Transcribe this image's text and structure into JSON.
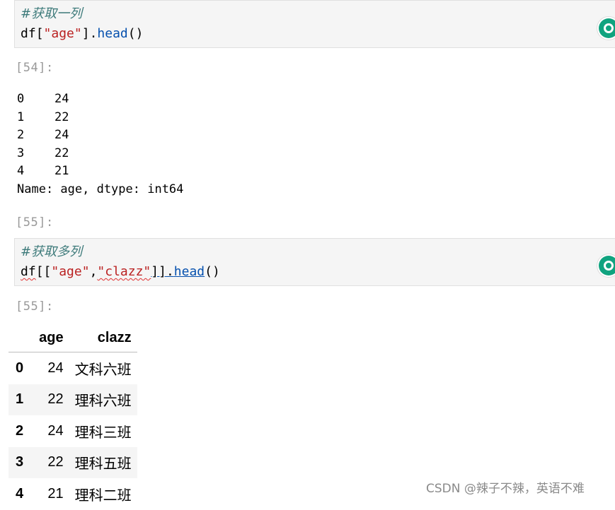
{
  "cells": [
    {
      "comment": "#获取一列",
      "code": {
        "var": "df",
        "open": "[",
        "str": "\"age\"",
        "close": "]",
        "dot": ".",
        "method": "head",
        "paren": "()"
      }
    },
    {
      "comment": "#获取多列",
      "code": {
        "var": "df",
        "open": "[[",
        "str1": "\"age\"",
        "comma": ",",
        "str2": "\"clazz\"",
        "close": "]]",
        "dot": ".",
        "method": "head",
        "paren": "()"
      }
    }
  ],
  "prompts": {
    "out1": "[54]:",
    "in2": "[55]:",
    "out2": "[55]:"
  },
  "series_output": {
    "rows": [
      {
        "index": "0",
        "value": "24"
      },
      {
        "index": "1",
        "value": "22"
      },
      {
        "index": "2",
        "value": "24"
      },
      {
        "index": "3",
        "value": "22"
      },
      {
        "index": "4",
        "value": "21"
      }
    ],
    "footer": "Name: age, dtype: int64"
  },
  "dataframe": {
    "columns": [
      "",
      "age",
      "clazz"
    ],
    "rows": [
      {
        "index": "0",
        "age": "24",
        "clazz": "文科六班"
      },
      {
        "index": "1",
        "age": "22",
        "clazz": "理科六班"
      },
      {
        "index": "2",
        "age": "24",
        "clazz": "理科三班"
      },
      {
        "index": "3",
        "age": "22",
        "clazz": "理科五班"
      },
      {
        "index": "4",
        "age": "21",
        "clazz": "理科二班"
      }
    ]
  },
  "icons": {
    "run": "chatgpt-icon",
    "accent": "#10a37f"
  },
  "watermark": "CSDN @辣子不辣，英语不难"
}
